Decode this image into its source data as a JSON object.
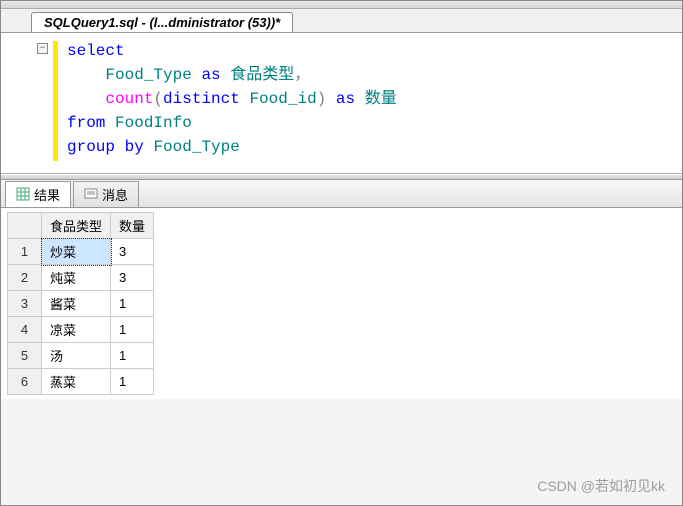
{
  "tab_title": "SQLQuery1.sql - (l...dministrator (53))*",
  "code": {
    "l1_select": "select",
    "l2_ident": "Food_Type",
    "l2_as": "as",
    "l2_alias": "食品类型",
    "l2_comma": "，",
    "l3_func": "count",
    "l3_open": "(",
    "l3_distinct": "distinct",
    "l3_arg": "Food_id",
    "l3_close": ")",
    "l3_as": "as",
    "l3_alias": "数量",
    "l4_from": "from",
    "l4_table": "FoodInfo",
    "l5_group": "group",
    "l5_by": "by",
    "l5_col": "Food_Type"
  },
  "tabs": {
    "results": "结果",
    "messages": "消息"
  },
  "columns": {
    "c1": "食品类型",
    "c2": "数量"
  },
  "rows": [
    {
      "n": "1",
      "c1": "炒菜",
      "c2": "3"
    },
    {
      "n": "2",
      "c1": "炖菜",
      "c2": "3"
    },
    {
      "n": "3",
      "c1": "酱菜",
      "c2": "1"
    },
    {
      "n": "4",
      "c1": "凉菜",
      "c2": "1"
    },
    {
      "n": "5",
      "c1": "汤",
      "c2": "1"
    },
    {
      "n": "6",
      "c1": "蒸菜",
      "c2": "1"
    }
  ],
  "watermark": "CSDN @若如初见kk"
}
